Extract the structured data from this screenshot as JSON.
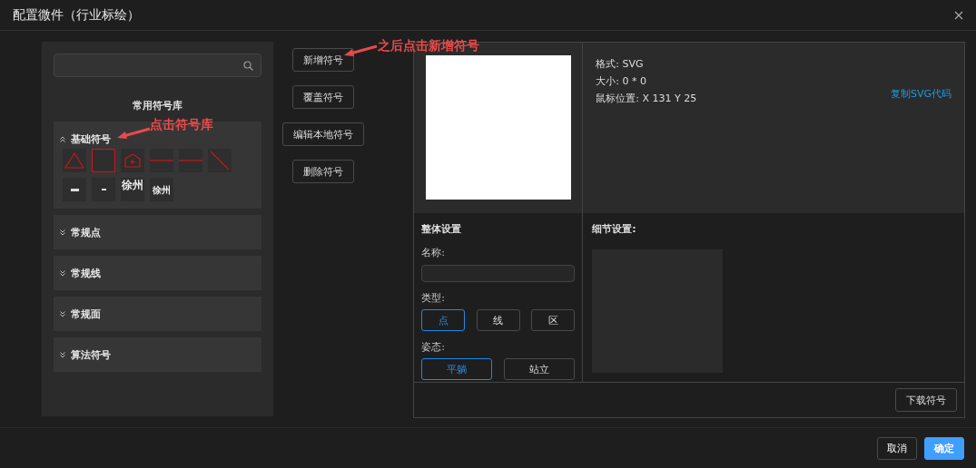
{
  "dialog": {
    "title": "配置微件（行业标绘）"
  },
  "library": {
    "title": "常用符号库",
    "groups": [
      {
        "label": "基础符号",
        "expanded": true,
        "symbols": [
          {
            "kind": "triangle"
          },
          {
            "kind": "square"
          },
          {
            "kind": "house"
          },
          {
            "kind": "line"
          },
          {
            "kind": "line"
          },
          {
            "kind": "diagonal"
          },
          {
            "kind": "tiny"
          },
          {
            "kind": "dash"
          },
          {
            "kind": "big-text",
            "text": "徐州"
          },
          {
            "kind": "small-text",
            "text": "徐州"
          }
        ]
      },
      {
        "label": "常规点",
        "expanded": false
      },
      {
        "label": "常规线",
        "expanded": false
      },
      {
        "label": "常规面",
        "expanded": false
      },
      {
        "label": "算法符号",
        "expanded": false
      }
    ]
  },
  "actions": [
    "新增符号",
    "覆盖符号",
    "编辑本地符号",
    "删除符号"
  ],
  "preview": {
    "info": [
      "格式: SVG",
      "大小: 0 * 0",
      "鼠标位置: X 131 Y 25"
    ],
    "copy_link": "复制SVG代码"
  },
  "settings": {
    "title": "整体设置",
    "name_label": "名称:",
    "type_label": "类型:",
    "types": [
      {
        "label": "点",
        "selected": true
      },
      {
        "label": "线",
        "selected": false
      },
      {
        "label": "区",
        "selected": false
      }
    ],
    "pose_label": "姿态:",
    "poses": [
      {
        "label": "平躺",
        "selected": true
      },
      {
        "label": "站立",
        "selected": false
      }
    ]
  },
  "detail": {
    "title": "细节设置:"
  },
  "download": "下载符号",
  "footer": {
    "buttons": [
      {
        "label": "取消",
        "kind": "default"
      },
      {
        "label": "确定",
        "kind": "primary"
      }
    ]
  },
  "annotations": [
    {
      "text": "之后点击新增符号"
    },
    {
      "text": "点击符号库"
    }
  ]
}
